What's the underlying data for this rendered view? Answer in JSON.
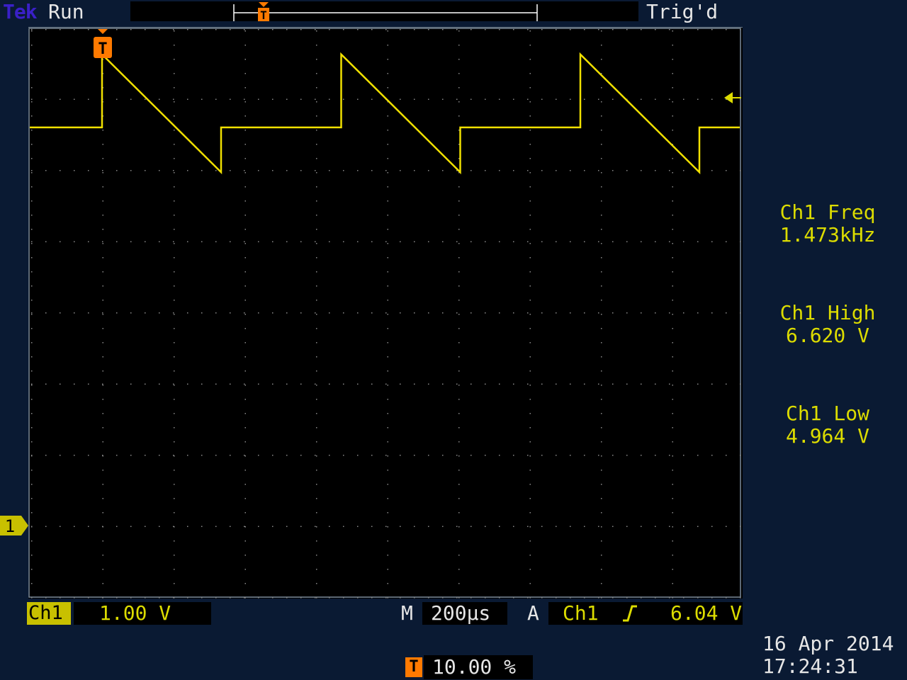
{
  "header": {
    "brand": "Tek",
    "run_state": "Run",
    "trigger_status": "Trig'd"
  },
  "channel": {
    "label": "Ch1",
    "scale": "1.00 V",
    "ground_marker": "1"
  },
  "timebase": {
    "label": "M",
    "value": "200µs"
  },
  "trigger": {
    "mode_label": "A",
    "source": "Ch1",
    "slope_symbol": "∫",
    "level": "6.04 V",
    "marker": "T"
  },
  "measurements": [
    {
      "name": "Ch1 Freq",
      "value": "1.473kHz"
    },
    {
      "name": "Ch1 High",
      "value": "6.620 V"
    },
    {
      "name": "Ch1 Low",
      "value": "4.964 V"
    }
  ],
  "horizontal_position": {
    "icon": "T",
    "value": "10.00 %"
  },
  "datetime": {
    "date": "16 Apr  2014",
    "time": "17:24:31"
  },
  "colors": {
    "background": "#0a1a33",
    "trace": "#f0e000",
    "trigger_marker": "#ff7a00",
    "channel_badge": "#c8c000"
  },
  "waveform": {
    "shape": "sawtooth",
    "units": "V",
    "high": 6.62,
    "low": 4.964
  }
}
